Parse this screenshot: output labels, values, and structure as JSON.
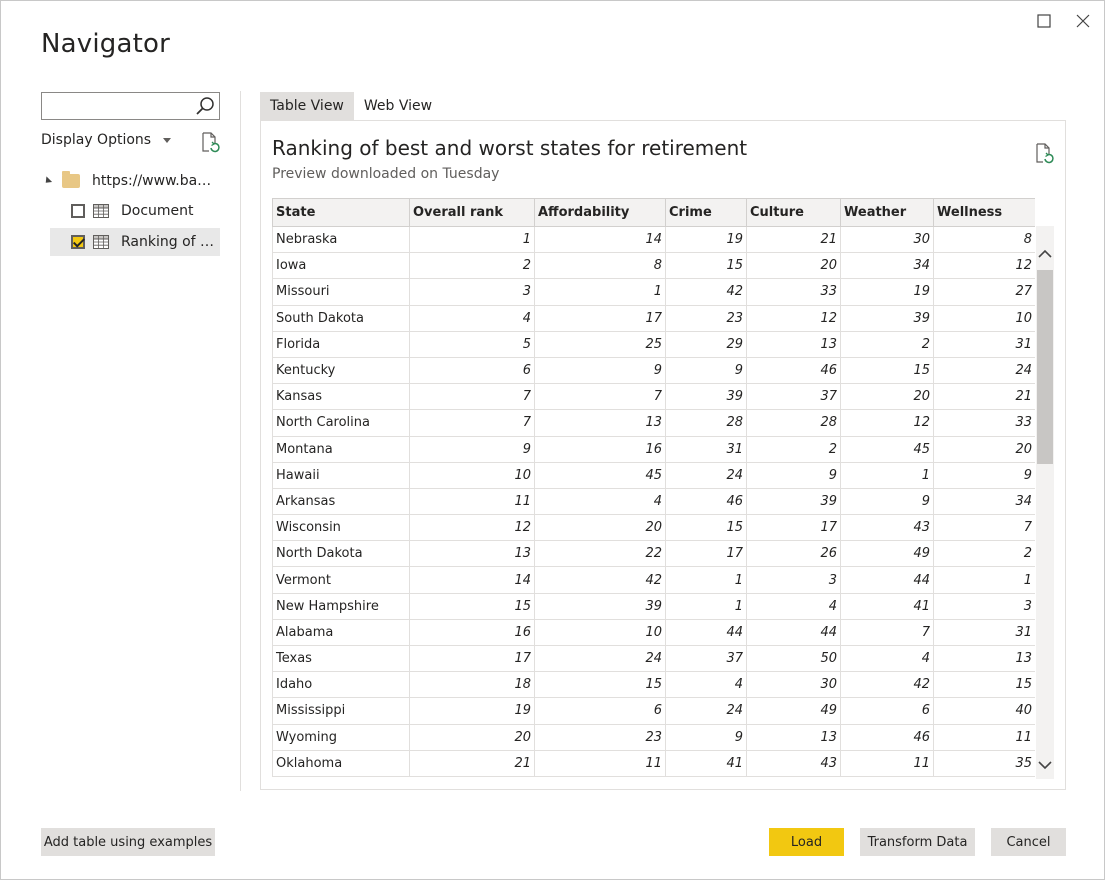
{
  "window": {
    "title": "Navigator"
  },
  "left_panel": {
    "search": {
      "value": "",
      "placeholder": ""
    },
    "display_options_label": "Display Options",
    "tree": {
      "root_label": "https://www.ban...",
      "items": [
        {
          "label": "Document",
          "checked": false
        },
        {
          "label": "Ranking of b...",
          "checked": true
        }
      ]
    }
  },
  "tabs": [
    {
      "label": "Table View",
      "active": true
    },
    {
      "label": "Web View",
      "active": false
    }
  ],
  "preview": {
    "title": "Ranking of best and worst states for retirement",
    "subtitle": "Preview downloaded on Tuesday",
    "columns": [
      "State",
      "Overall rank",
      "Affordability",
      "Crime",
      "Culture",
      "Weather",
      "Wellness"
    ],
    "rows": [
      [
        "Nebraska",
        "1",
        "14",
        "19",
        "21",
        "30",
        "8"
      ],
      [
        "Iowa",
        "2",
        "8",
        "15",
        "20",
        "34",
        "12"
      ],
      [
        "Missouri",
        "3",
        "1",
        "42",
        "33",
        "19",
        "27"
      ],
      [
        "South Dakota",
        "4",
        "17",
        "23",
        "12",
        "39",
        "10"
      ],
      [
        "Florida",
        "5",
        "25",
        "29",
        "13",
        "2",
        "31"
      ],
      [
        "Kentucky",
        "6",
        "9",
        "9",
        "46",
        "15",
        "24"
      ],
      [
        "Kansas",
        "7",
        "7",
        "39",
        "37",
        "20",
        "21"
      ],
      [
        "North Carolina",
        "7",
        "13",
        "28",
        "28",
        "12",
        "33"
      ],
      [
        "Montana",
        "9",
        "16",
        "31",
        "2",
        "45",
        "20"
      ],
      [
        "Hawaii",
        "10",
        "45",
        "24",
        "9",
        "1",
        "9"
      ],
      [
        "Arkansas",
        "11",
        "4",
        "46",
        "39",
        "9",
        "34"
      ],
      [
        "Wisconsin",
        "12",
        "20",
        "15",
        "17",
        "43",
        "7"
      ],
      [
        "North Dakota",
        "13",
        "22",
        "17",
        "26",
        "49",
        "2"
      ],
      [
        "Vermont",
        "14",
        "42",
        "1",
        "3",
        "44",
        "1"
      ],
      [
        "New Hampshire",
        "15",
        "39",
        "1",
        "4",
        "41",
        "3"
      ],
      [
        "Alabama",
        "16",
        "10",
        "44",
        "44",
        "7",
        "31"
      ],
      [
        "Texas",
        "17",
        "24",
        "37",
        "50",
        "4",
        "13"
      ],
      [
        "Idaho",
        "18",
        "15",
        "4",
        "30",
        "42",
        "15"
      ],
      [
        "Mississippi",
        "19",
        "6",
        "24",
        "49",
        "6",
        "40"
      ],
      [
        "Wyoming",
        "20",
        "23",
        "9",
        "13",
        "46",
        "11"
      ],
      [
        "Oklahoma",
        "21",
        "11",
        "41",
        "43",
        "11",
        "35"
      ]
    ]
  },
  "buttons": {
    "add_table": "Add table using examples",
    "load": "Load",
    "transform": "Transform Data",
    "cancel": "Cancel"
  },
  "colors": {
    "accent": "#f2c811",
    "selected_row": "#e8e8e8",
    "header_bg": "#f3f2f1"
  },
  "icons": [
    "maximize-icon",
    "close-icon",
    "search-icon",
    "refresh-icon",
    "folder-icon",
    "table-icon",
    "chevron-up-icon",
    "chevron-down-icon"
  ]
}
